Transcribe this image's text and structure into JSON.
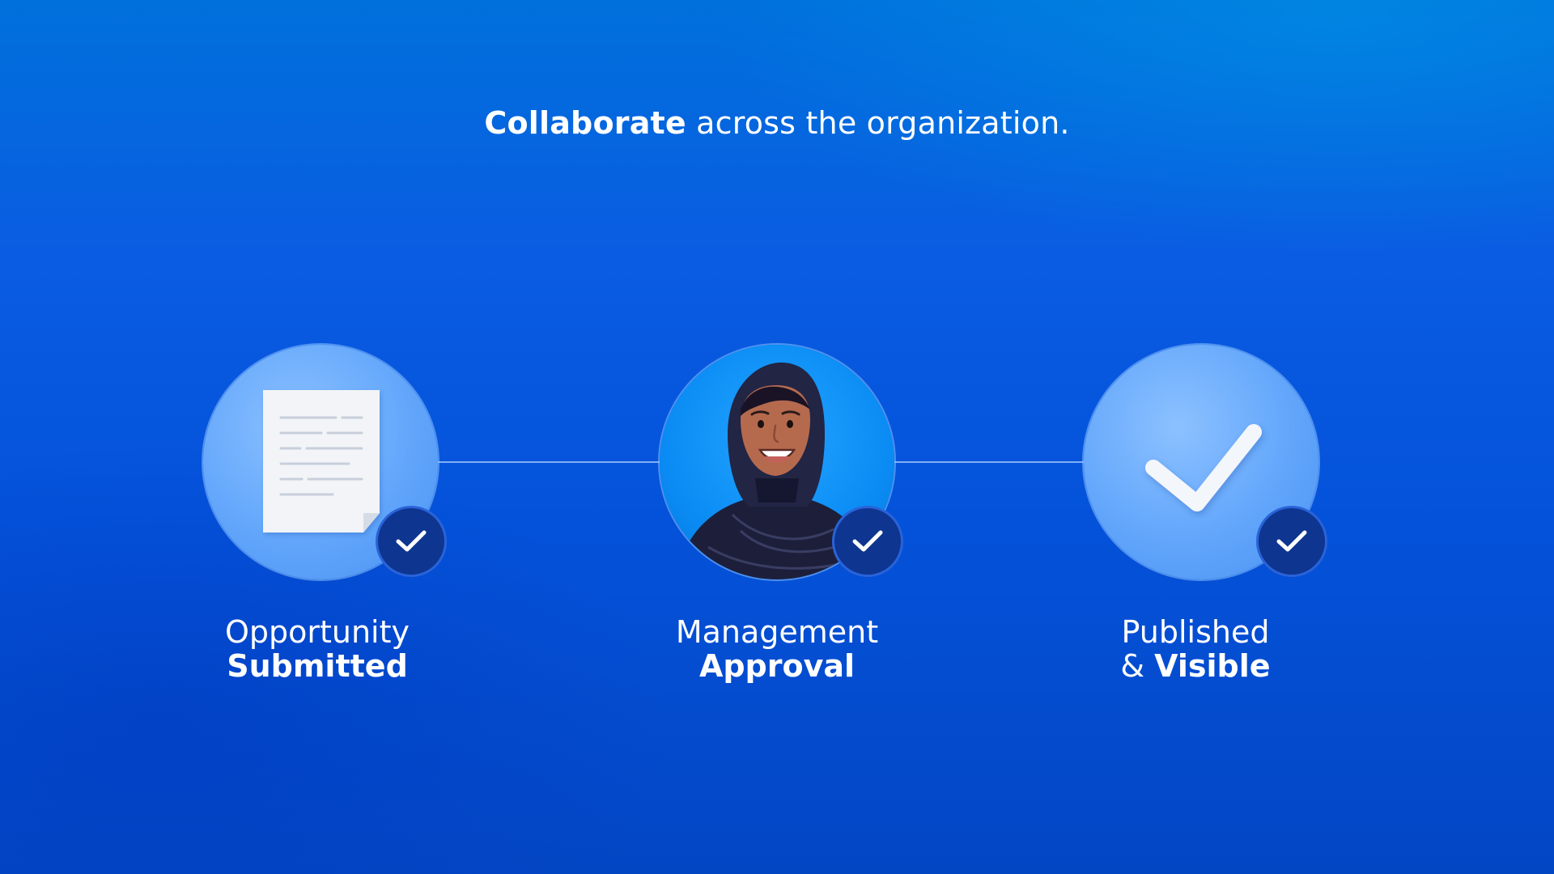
{
  "headline": {
    "bold": "Collaborate",
    "rest": " across the organization."
  },
  "steps": [
    {
      "icon": "document-icon",
      "label_regular": "Opportunity",
      "label_bold": "Submitted"
    },
    {
      "icon": "avatar-person",
      "label_regular": "Management",
      "label_bold": "Approval"
    },
    {
      "icon": "checkmark-icon",
      "label_prefix": "Published",
      "label_amp": "& ",
      "label_bold": "Visible"
    }
  ],
  "colors": {
    "background": "#0452da",
    "circle_light": "#62a6fb",
    "badge": "#0e3590",
    "text": "#ffffff"
  }
}
